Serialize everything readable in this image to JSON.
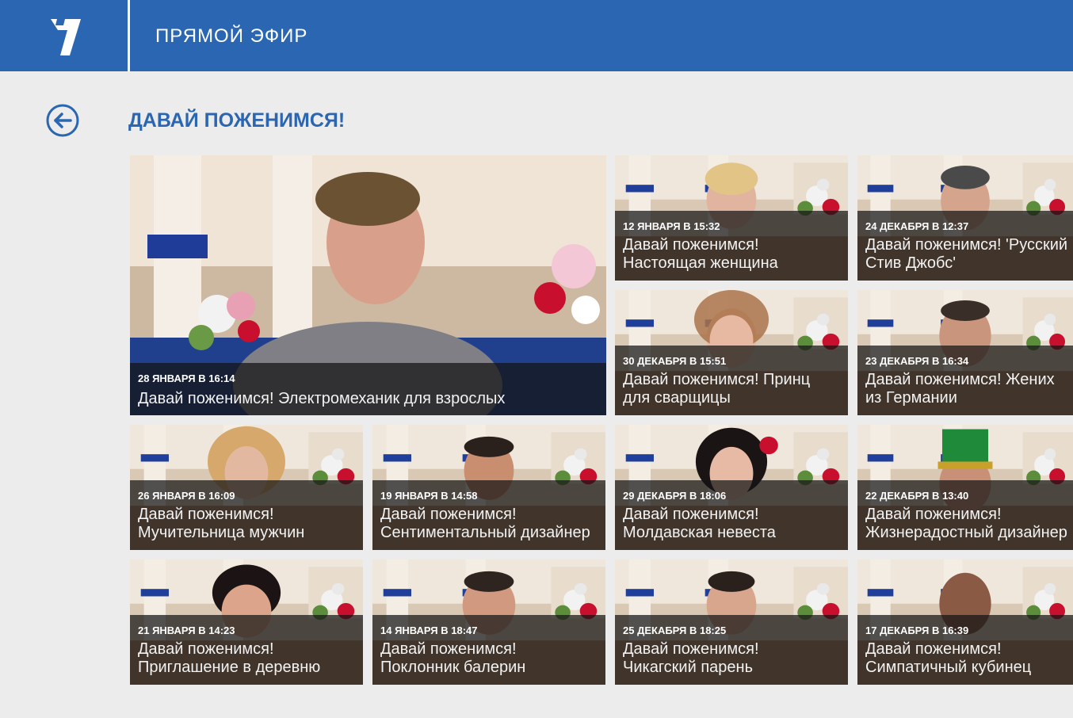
{
  "header": {
    "nav_label": "ПРЯМОЙ ЭФИР",
    "brand_color": "#2a66b1"
  },
  "page": {
    "title": "ДАВАЙ ПОЖЕНИМСЯ!",
    "back_icon": "back-arrow-icon"
  },
  "featured": {
    "date": "28 ЯНВАРЯ В 16:14",
    "title": "Давай поженимся! Электромеханик для взрослых"
  },
  "episodes": [
    {
      "date": "12 ЯНВАРЯ В 15:32",
      "title": "Давай поженимся!\nНастоящая женщина"
    },
    {
      "date": "24 ДЕКАБРЯ В 12:37",
      "title": "Давай поженимся! 'Русский\nСтив Джобс'"
    },
    {
      "date": "30 ДЕКАБРЯ В 15:51",
      "title": "Давай поженимся! Принц\nдля сварщицы"
    },
    {
      "date": "23 ДЕКАБРЯ В 16:34",
      "title": "Давай поженимся! Жених\nиз Германии"
    },
    {
      "date": "26 ЯНВАРЯ В 16:09",
      "title": "Давай поженимся!\nМучительница мужчин"
    },
    {
      "date": "19 ЯНВАРЯ В 14:58",
      "title": "Давай поженимся!\nСентиментальный дизайнер"
    },
    {
      "date": "29 ДЕКАБРЯ В 18:06",
      "title": "Давай поженимся!\nМолдавская невеста"
    },
    {
      "date": "22 ДЕКАБРЯ В 13:40",
      "title": "Давай поженимся!\nЖизнерадостный дизайнер"
    },
    {
      "date": "21 ЯНВАРЯ В 14:23",
      "title": "Давай поженимся!\nПриглашение в деревню"
    },
    {
      "date": "14 ЯНВАРЯ В 18:47",
      "title": "Давай поженимся!\nПоклонник балерин"
    },
    {
      "date": "25 ДЕКАБРЯ В 18:25",
      "title": "Давай поженимся!\nЧикагский парень"
    },
    {
      "date": "17 ДЕКАБРЯ В 16:39",
      "title": "Давай поженимся!\nСимпатичный кубинец"
    }
  ]
}
